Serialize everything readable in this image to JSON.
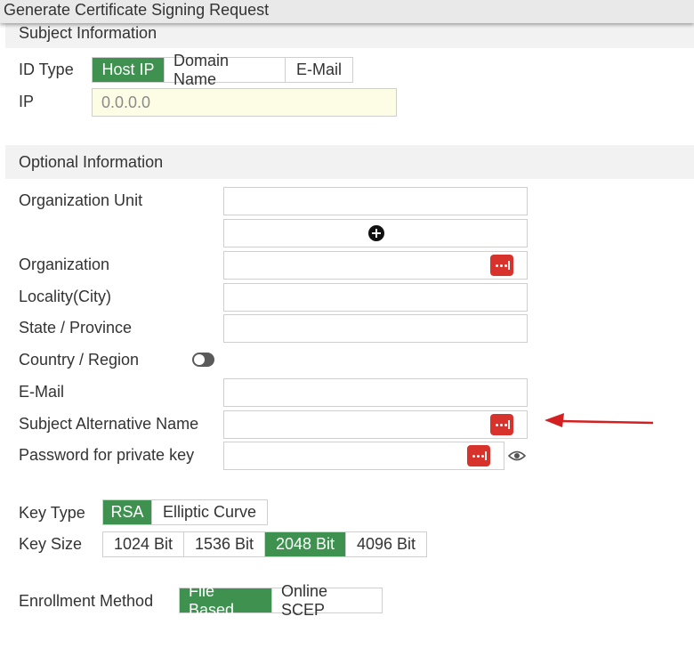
{
  "window": {
    "title": "Generate Certificate Signing Request"
  },
  "subject": {
    "header": "Subject Information",
    "id_type_label": "ID Type",
    "id_type_options": [
      "Host IP",
      "Domain Name",
      "E-Mail"
    ],
    "id_type_selected": "Host IP",
    "ip_label": "IP",
    "ip_placeholder": "0.0.0.0"
  },
  "optional": {
    "header": "Optional Information",
    "org_unit_label": "Organization Unit",
    "organization_label": "Organization",
    "locality_label": "Locality(City)",
    "state_label": "State / Province",
    "country_label": "Country / Region",
    "email_label": "E-Mail",
    "san_label": "Subject Alternative Name",
    "password_label": "Password for private key"
  },
  "key": {
    "type_label": "Key Type",
    "type_options": [
      "RSA",
      "Elliptic Curve"
    ],
    "type_selected": "RSA",
    "size_label": "Key Size",
    "size_options": [
      "1024 Bit",
      "1536 Bit",
      "2048 Bit",
      "4096 Bit"
    ],
    "size_selected": "2048 Bit"
  },
  "enrollment": {
    "label": "Enrollment Method",
    "options": [
      "File Based",
      "Online SCEP"
    ],
    "selected": "File Based"
  },
  "colors": {
    "accent": "#3f9150",
    "danger": "#d8322d",
    "annotation_arrow": "#d42020",
    "ip_field_bg": "#fdfde6"
  },
  "icons": [
    "plus-circle-icon",
    "more-dots-icon",
    "toggle-switch",
    "eye-icon",
    "annotation-arrow"
  ]
}
